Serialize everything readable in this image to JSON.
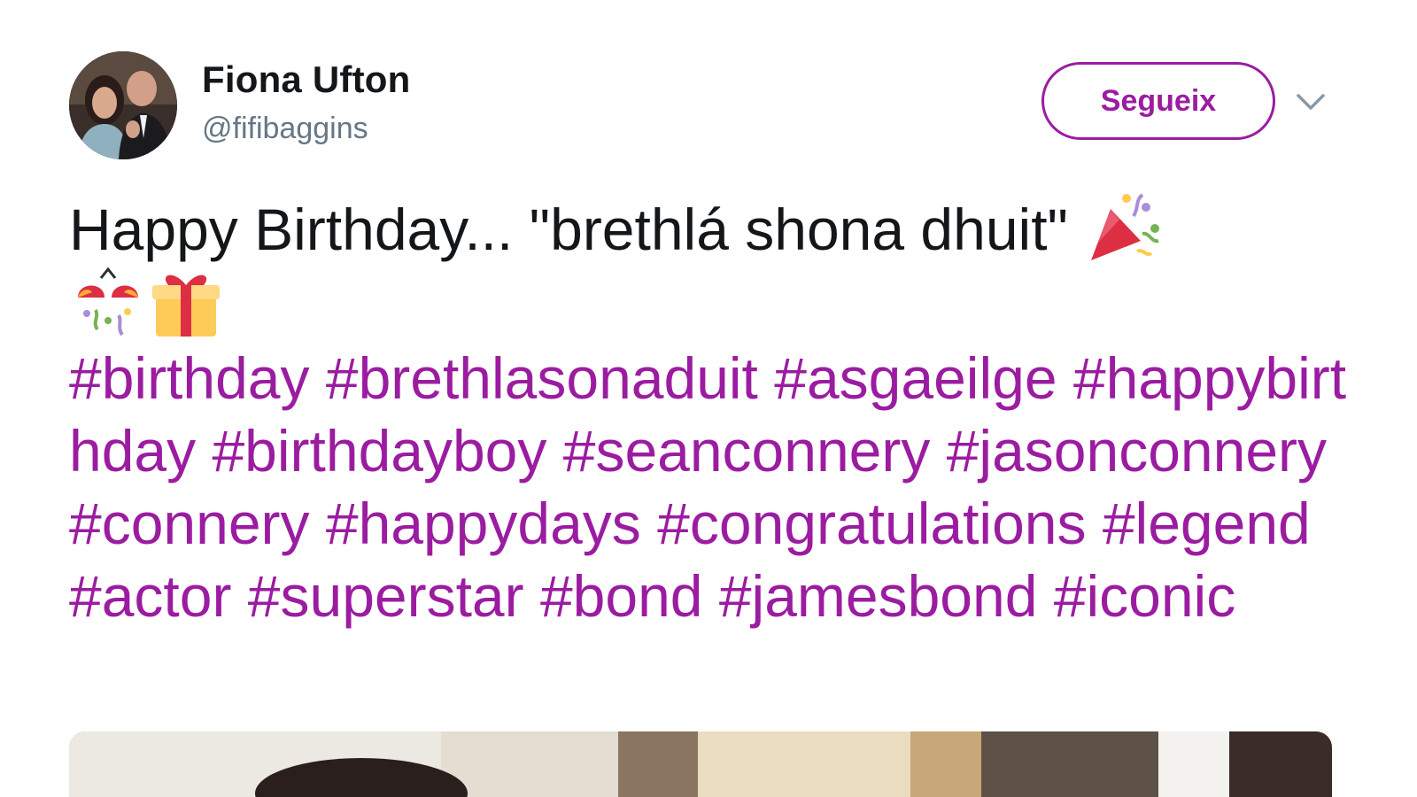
{
  "user": {
    "name": "Fiona Ufton",
    "handle": "@fifibaggins"
  },
  "follow_button": {
    "label": "Segueix"
  },
  "icons": {
    "more_menu": "chevron-down-icon",
    "emoji_1": "party-popper-icon",
    "emoji_2": "confetti-ball-icon",
    "emoji_3": "wrapped-gift-icon"
  },
  "tweet": {
    "text": "Happy Birthday... \"brethlá shona dhuit\" ",
    "hashtags": [
      "#birthday",
      "#brethlasonaduit",
      "#asgaeilge",
      "#happybirthday",
      "#birthdayboy",
      "#seanconnery",
      "#jasonconnery",
      "#connery",
      "#happydays",
      "#congratulations",
      "#legend",
      "#actor",
      "#superstar",
      "#bond",
      "#jamesbond",
      "#iconic"
    ]
  },
  "colors": {
    "accent": "#9b1ca1",
    "text": "#14171a",
    "secondary_text": "#657786"
  }
}
